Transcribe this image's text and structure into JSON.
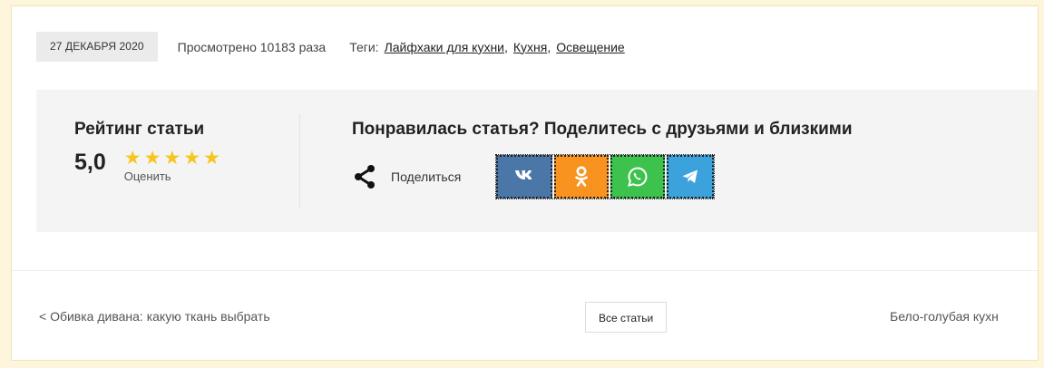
{
  "meta": {
    "date": "27 ДЕКАБРЯ 2020",
    "views": "Просмотрено 10183 раза",
    "tags_label": "Теги:",
    "tags": [
      "Лайфхаки для кухни",
      "Кухня",
      "Освещение"
    ],
    "tag_separator": ","
  },
  "rating": {
    "title": "Рейтинг статьи",
    "value": "5,0",
    "stars_filled": 5,
    "stars_total": 5,
    "rate_label": "Оценить"
  },
  "share": {
    "title": "Понравилась статья? Поделитесь с друзьями и близкими",
    "share_label": "Поделиться",
    "networks": [
      {
        "name": "vk",
        "icon": "vk-icon",
        "color": "#4a76a8"
      },
      {
        "name": "ok",
        "icon": "odnoklassniki-icon",
        "color": "#f7931e"
      },
      {
        "name": "whatsapp",
        "icon": "whatsapp-icon",
        "color": "#3dc24e"
      },
      {
        "name": "telegram",
        "icon": "telegram-icon",
        "color": "#3ba2dc"
      }
    ]
  },
  "navigation": {
    "prev": "< Обивка дивана: какую ткань выбрать",
    "all": "Все статьи",
    "next": "Бело-голубая кухн"
  },
  "colors": {
    "star": "#f8c51d",
    "panel_bg": "#f4f4f4",
    "date_badge_bg": "#ebebeb"
  }
}
